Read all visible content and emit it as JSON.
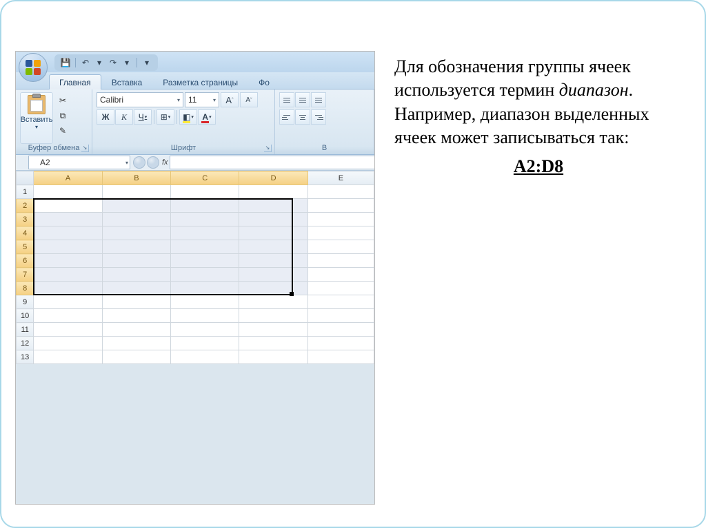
{
  "text": {
    "p1a": "Для обозначения группы ячеек используется термин ",
    "term": "диапазон",
    "p1b": ". Например, диапазон выделенных ячеек может записываться так:",
    "range": "A2:D8"
  },
  "excel": {
    "tabs": {
      "home": "Главная",
      "insert": "Вставка",
      "layout": "Разметка страницы",
      "formulas": "Фо"
    },
    "clipboard": {
      "paste": "Вставить",
      "group": "Буфер обмена"
    },
    "font": {
      "name": "Calibri",
      "size": "11",
      "grow": "A",
      "shrink": "A",
      "bold": "Ж",
      "italic": "К",
      "underline": "Ч",
      "fontcolor": "A",
      "group": "Шрифт"
    },
    "align": {
      "group": "В"
    },
    "namebox": "A2",
    "fx": "fx",
    "cols": [
      "A",
      "B",
      "C",
      "D",
      "E"
    ],
    "rows": [
      "1",
      "2",
      "3",
      "4",
      "5",
      "6",
      "7",
      "8",
      "9",
      "10",
      "11",
      "12",
      "13"
    ]
  },
  "icons": {
    "cut": "✂",
    "copy": "⧉",
    "fmt": "✎",
    "save": "💾",
    "undo": "↶",
    "redo": "↷",
    "dd": "▾",
    "border": "⊞",
    "fill": "◧"
  }
}
